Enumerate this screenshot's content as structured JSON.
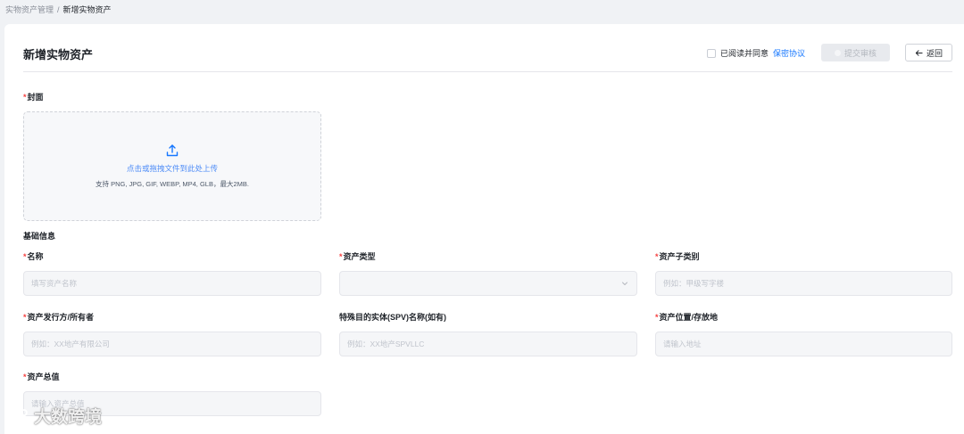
{
  "breadcrumb": {
    "parent": "实物资产管理",
    "separator": "/",
    "current": "新增实物资产"
  },
  "header": {
    "title": "新增实物资产",
    "agree_text": "已阅读并同意",
    "agree_link": "保密协议",
    "submit_label": "提交审核",
    "back_label": "返回"
  },
  "cover": {
    "required_mark": "*",
    "label": "封面",
    "upload_text": "点击或拖拽文件到此处上传",
    "upload_hint": "支持 PNG, JPG, GIF, WEBP, MP4, GLB，最大2MB."
  },
  "basic_info": {
    "title": "基础信息"
  },
  "fields": {
    "name": {
      "label": "名称",
      "placeholder": "填写资产名称"
    },
    "asset_type": {
      "label": "资产类型",
      "value": ""
    },
    "asset_subtype": {
      "label": "资产子类别",
      "placeholder": "例如：甲级写字楼"
    },
    "issuer": {
      "label": "资产发行方/所有者",
      "placeholder": "例如：XX地产有限公司"
    },
    "spv": {
      "label": "特殊目的实体(SPV)名称(如有)",
      "placeholder": "例如：XX地产SPVLLC"
    },
    "location": {
      "label": "资产位置/存放地",
      "placeholder": "请输入地址"
    },
    "total_value": {
      "label": "资产总值",
      "placeholder": "请输入资产总值"
    }
  },
  "watermark": {
    "text": "大数跨境"
  },
  "colors": {
    "accent": "#1677ff",
    "required": "#f53f3f",
    "page_bg": "#f0f2f5"
  }
}
